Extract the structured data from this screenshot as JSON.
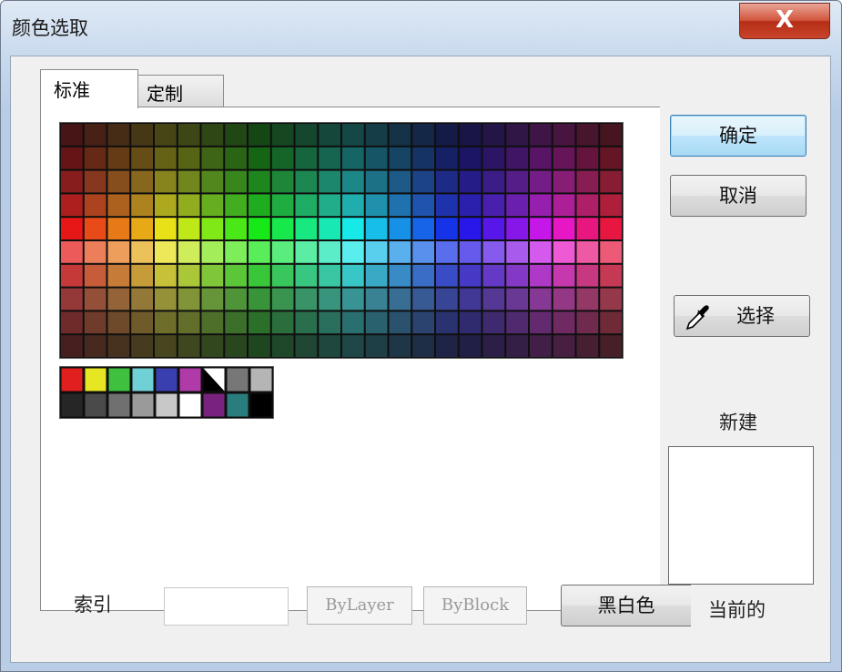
{
  "window": {
    "title": "颜色选取",
    "close_label": "X"
  },
  "tabs": [
    {
      "label": "标准"
    },
    {
      "label": "定制"
    }
  ],
  "palette": {
    "columns": 24,
    "rows": 10,
    "hues": [
      "red",
      "orange",
      "amber",
      "yellow",
      "lime",
      "green",
      "green",
      "green",
      "green",
      "teal",
      "teal",
      "cyan",
      "azure",
      "blue",
      "blue",
      "indigo",
      "violet",
      "purple",
      "magenta",
      "pink",
      "rose",
      "crimson"
    ]
  },
  "standard_colors": {
    "row1": [
      "#e21f1f",
      "#e6e622",
      "#3fc03f",
      "#6fd0d6",
      "#3a3fb0",
      "#b03aa8",
      "#ffffff/#000000",
      "#777777",
      "#b5b5b5"
    ],
    "row2": [
      "#262626",
      "#4a4a4a",
      "#707070",
      "#9a9a9a",
      "#c8c8c8",
      "#ffffff",
      "#7a237e",
      "#2a7d7d",
      "#000000"
    ]
  },
  "index": {
    "label": "索引",
    "value": ""
  },
  "buttons": {
    "bylayer": "ByLayer",
    "byblock": "ByBlock",
    "black_white": "黑白色",
    "ok": "确定",
    "cancel": "取消",
    "pick": "选择"
  },
  "preview": {
    "new_label": "新建",
    "current_label": "当前的"
  }
}
